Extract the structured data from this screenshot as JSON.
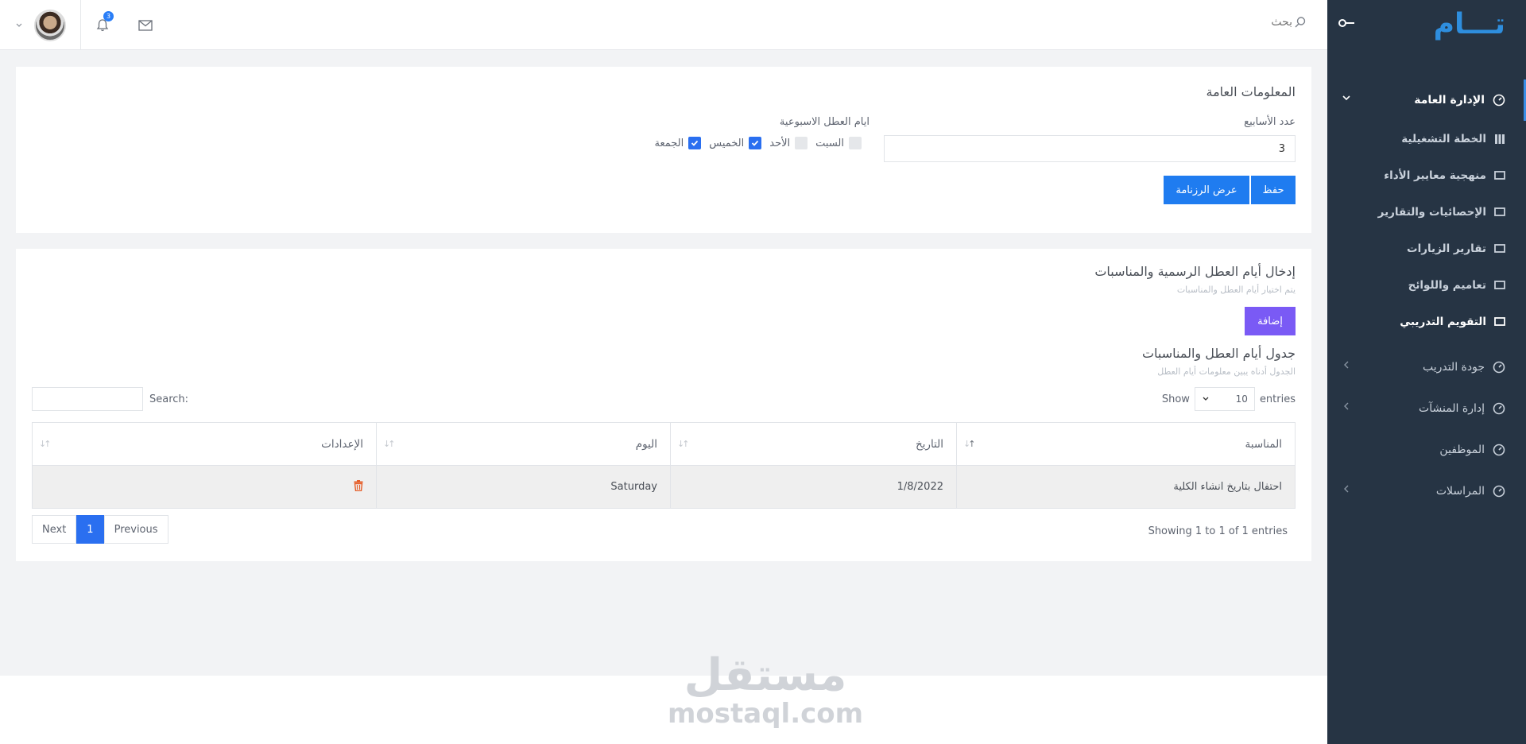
{
  "sidebar": {
    "logo_text": "تـــام",
    "items": [
      {
        "label": "الإدارة العامة",
        "icon": "dashboard-icon",
        "expanded": true
      },
      {
        "label": "جودة التدريب",
        "icon": "dashboard-icon"
      },
      {
        "label": "إدارة المنشآت",
        "icon": "dashboard-icon"
      },
      {
        "label": "الموظفين",
        "icon": "dashboard-icon"
      },
      {
        "label": "المراسلات",
        "icon": "dashboard-icon"
      }
    ],
    "sub_items": [
      {
        "label": "الخطة التشغيلية",
        "icon": "grid-icon"
      },
      {
        "label": "منهجية معايير الأداء",
        "icon": "screen-icon"
      },
      {
        "label": "الإحصائيات والتقارير",
        "icon": "screen-icon"
      },
      {
        "label": "تقارير الزيارات",
        "icon": "screen-icon"
      },
      {
        "label": "تعاميم واللوائح",
        "icon": "screen-icon"
      },
      {
        "label": "التقويم التدريبي",
        "icon": "screen-icon",
        "current": true
      }
    ]
  },
  "topbar": {
    "search_placeholder": "بحث",
    "notification_count": "3"
  },
  "general_info": {
    "title": "المعلومات العامة",
    "weeks_label": "عدد الأسابيع",
    "weeks_value": "3",
    "weekend_label": "ايام العطل الاسبوعية",
    "days": [
      {
        "label": "السبت",
        "checked": false
      },
      {
        "label": "الأحد",
        "checked": false
      },
      {
        "label": "الخميس",
        "checked": true
      },
      {
        "label": "الجمعة",
        "checked": true
      }
    ],
    "save_label": "حفظ",
    "show_calendar_label": "عرض الرزنامة"
  },
  "holidays": {
    "title": "إدخال أيام العطل الرسمية والمناسبات",
    "subtitle": "يتم اختيار أيام العطل والمناسبات",
    "add_label": "إضافة",
    "table_title": "جدول أيام العطل والمناسبات",
    "table_subtitle": "الجدول أدناه يبين معلومات أيام العطل",
    "show_label": "Show",
    "entries_value": "10",
    "entries_label": "entries",
    "search_label": "Search:",
    "columns": [
      "المناسبة",
      "التاريخ",
      "اليوم",
      "الإعدادات"
    ],
    "rows": [
      {
        "occasion": "احتفال بتاريخ انشاء الكلية",
        "date": "1/8/2022",
        "day": "Saturday"
      }
    ],
    "info": "Showing 1 to 1 of 1 entries",
    "pager": {
      "previous": "Previous",
      "current": "1",
      "next": "Next"
    }
  },
  "watermark": {
    "arabic": "مستقل",
    "english": "mostaql.com"
  }
}
